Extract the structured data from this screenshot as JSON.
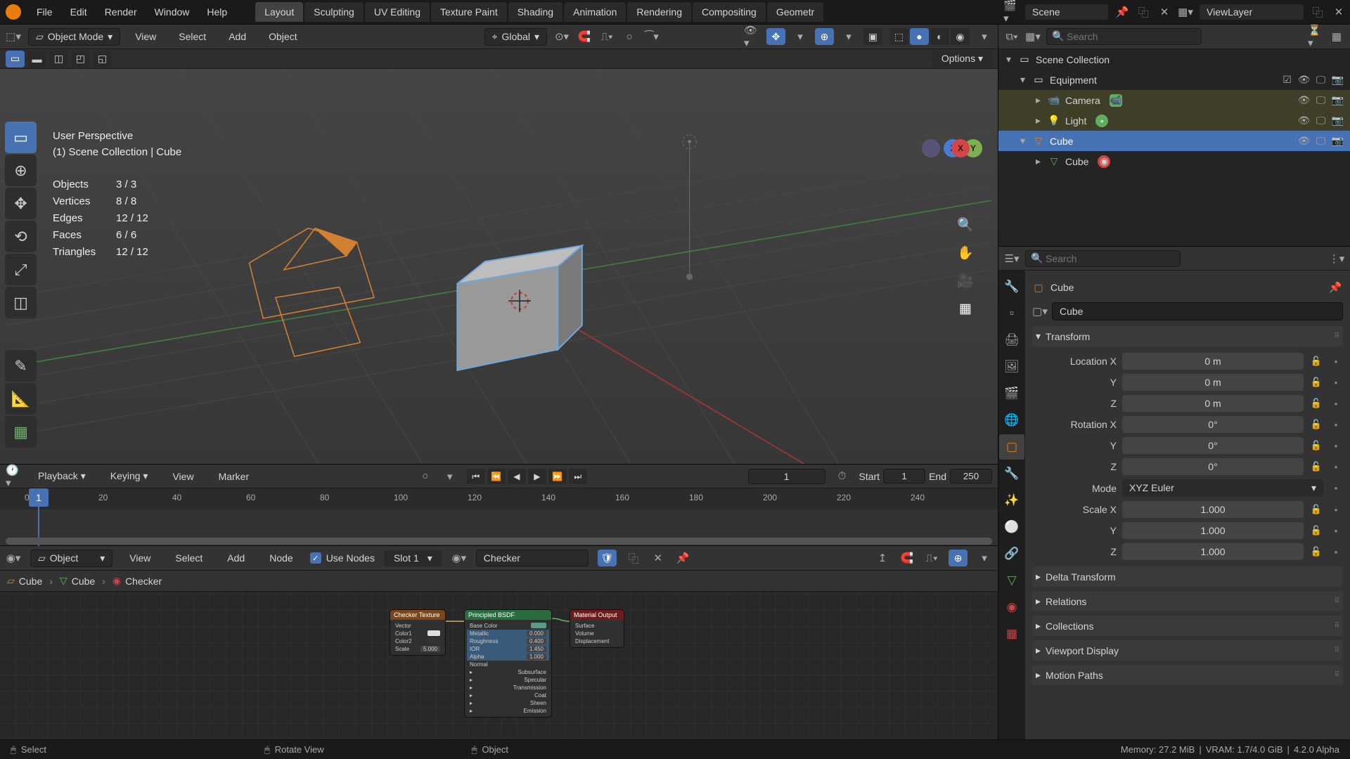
{
  "menu": {
    "file": "File",
    "edit": "Edit",
    "render": "Render",
    "window": "Window",
    "help": "Help"
  },
  "workspaces": [
    "Layout",
    "Sculpting",
    "UV Editing",
    "Texture Paint",
    "Shading",
    "Animation",
    "Rendering",
    "Compositing",
    "Geometr"
  ],
  "workspaces_active": 0,
  "scene": {
    "name": "Scene"
  },
  "viewlayer": {
    "name": "ViewLayer"
  },
  "viewport_header": {
    "mode": "Object Mode",
    "view": "View",
    "select": "Select",
    "add": "Add",
    "object": "Object",
    "orientation": "Global",
    "options": "Options"
  },
  "viewport_overlay": {
    "title": "User Perspective",
    "context": "(1) Scene Collection | Cube",
    "stats": {
      "objects_label": "Objects",
      "objects": "3 / 3",
      "vertices_label": "Vertices",
      "vertices": "8 / 8",
      "edges_label": "Edges",
      "edges": "12 / 12",
      "faces_label": "Faces",
      "faces": "6 / 6",
      "tris_label": "Triangles",
      "tris": "12 / 12"
    }
  },
  "axes": {
    "x": "X",
    "y": "Y",
    "z": "Z"
  },
  "timeline": {
    "playback": "Playback",
    "keying": "Keying",
    "view": "View",
    "marker": "Marker",
    "current": "1",
    "start_label": "Start",
    "start": "1",
    "end_label": "End",
    "end": "250",
    "ticks": [
      "0",
      "20",
      "40",
      "60",
      "80",
      "100",
      "120",
      "140",
      "160",
      "180",
      "200",
      "220",
      "240"
    ]
  },
  "shader": {
    "type": "Object",
    "view": "View",
    "select": "Select",
    "add": "Add",
    "node": "Node",
    "use_nodes": "Use Nodes",
    "slot": "Slot 1",
    "material": "Checker",
    "breadcrumb": {
      "object": "Cube",
      "mesh": "Cube",
      "material": "Checker"
    },
    "nodes": {
      "checker": {
        "title": "Checker Texture",
        "rows": [
          [
            "Vector",
            ""
          ],
          [
            "Color1",
            ""
          ],
          [
            "Color2",
            ""
          ],
          [
            "Scale",
            "5.000"
          ]
        ]
      },
      "bsdf": {
        "title": "Principled BSDF",
        "rows": [
          [
            "Base Color",
            ""
          ],
          [
            "Metallic",
            "0.000"
          ],
          [
            "Roughness",
            "0.400"
          ],
          [
            "IOR",
            "1.450"
          ],
          [
            "Alpha",
            "1.000"
          ],
          [
            "Normal",
            ""
          ],
          [
            "Subsurface",
            ""
          ],
          [
            "Specular",
            ""
          ],
          [
            "Transmission",
            ""
          ],
          [
            "Coat",
            ""
          ],
          [
            "Sheen",
            ""
          ],
          [
            "Emission",
            ""
          ]
        ]
      },
      "output": {
        "title": "Material Output",
        "rows": [
          [
            "Surface",
            ""
          ],
          [
            "Volume",
            ""
          ],
          [
            "Displacement",
            ""
          ]
        ]
      }
    }
  },
  "outliner": {
    "search_ph": "Search",
    "root": "Scene Collection",
    "collection": "Equipment",
    "items": {
      "camera": "Camera",
      "light": "Light",
      "cube": "Cube",
      "cube_mesh": "Cube"
    }
  },
  "properties": {
    "search_ph": "Search",
    "object_name": "Cube",
    "datablock_name": "Cube",
    "panels": {
      "transform": "Transform",
      "delta": "Delta Transform",
      "relations": "Relations",
      "collections": "Collections",
      "viewport": "Viewport Display",
      "motion": "Motion Paths"
    },
    "transform": {
      "loc_label": "Location X",
      "y_label": "Y",
      "z_label": "Z",
      "loc_x": "0 m",
      "loc_y": "0 m",
      "loc_z": "0 m",
      "rot_label": "Rotation X",
      "rot_x": "0°",
      "rot_y": "0°",
      "rot_z": "0°",
      "mode_label": "Mode",
      "mode": "XYZ Euler",
      "scale_label": "Scale X",
      "scale_x": "1.000",
      "scale_y": "1.000",
      "scale_z": "1.000"
    }
  },
  "status": {
    "select": "Select",
    "rotate": "Rotate View",
    "object": "Object",
    "memory": "Memory: 27.2 MiB",
    "vram": "VRAM: 1.7/4.0 GiB",
    "version": "4.2.0 Alpha"
  }
}
